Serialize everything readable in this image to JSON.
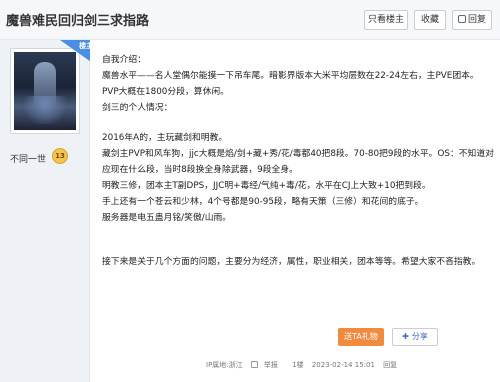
{
  "header": {
    "title": "魔兽难民回归剑三求指路",
    "only_op": "只看楼主",
    "favorite": "收藏",
    "reply": "回复"
  },
  "user": {
    "name": "不同一世",
    "level": "13"
  },
  "badge": {
    "text": "楼主"
  },
  "post": {
    "lines": [
      "自我介绍：",
      "魔兽水平——名人堂偶尔能摸一下吊车尾。暗影界版本大米平均层数在22-24左右，主PVE团本。PVP大概在1800分段，算休闲。",
      "剑三的个人情况：",
      "2016年A的，主玩藏剑和明教。",
      "藏剑主PVP和风车狗，jjc大概是焰/剑+藏+秀/花/毒都40把8段。70-80把9段的水平。OS：不知道对应现在什么段，当时8段换全身除武器，9段全身。",
      "明教三修，团本主T副DPS，JJC明+毒经/气纯+毒/花，水平在CJ上大致+10把到段。",
      "手上还有一个苍云和少林，4个号都是90-95段，略有天策（三修）和花间的底子。",
      "服务器是电五蛊月铭/笑傲/山雨。",
      "接下来是关于几个方面的问题，主要分为经济，属性，职业相关，团本等等。希望大家不吝指教。"
    ]
  },
  "actions": {
    "gift": "送TA礼物",
    "share": "分享"
  },
  "footer": {
    "ip": "IP属地:浙江",
    "report": "举报",
    "floor": "1楼",
    "time": "2023-02-14 15:01",
    "reply": "回复"
  }
}
